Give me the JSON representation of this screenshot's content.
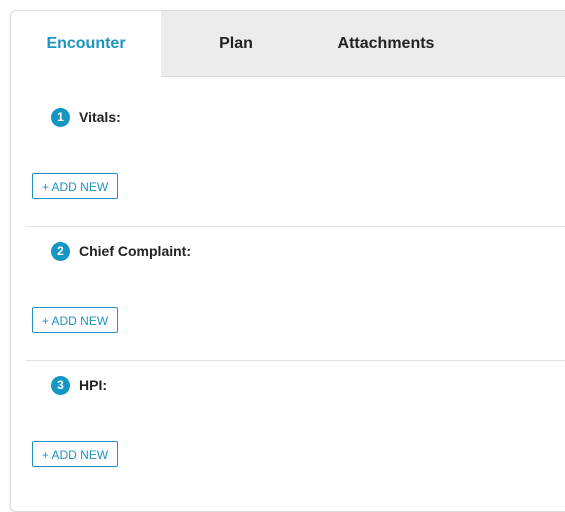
{
  "tabs": {
    "encounter": "Encounter",
    "plan": "Plan",
    "attachments": "Attachments"
  },
  "sections": [
    {
      "number": "1",
      "title": "Vitals:",
      "button": "+ ADD NEW"
    },
    {
      "number": "2",
      "title": "Chief Complaint:",
      "button": "+ ADD NEW"
    },
    {
      "number": "3",
      "title": "HPI:",
      "button": "+ ADD NEW"
    }
  ],
  "colors": {
    "accent": "#1e93c0",
    "tabbar_bg": "#ececec"
  }
}
